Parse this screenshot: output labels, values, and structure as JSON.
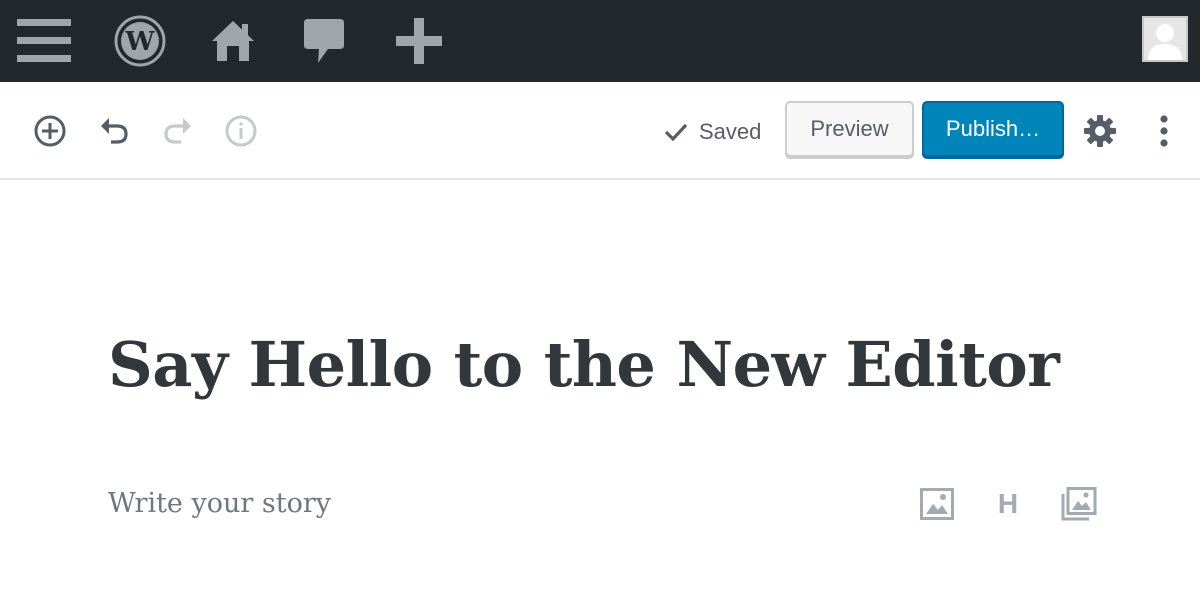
{
  "admin_bar": {
    "icons": [
      "menu-icon",
      "wordpress-logo-icon",
      "home-icon",
      "comment-icon",
      "plus-icon"
    ],
    "avatar_icon": "user-avatar-icon"
  },
  "toolbar": {
    "left_icons": [
      "add-block-icon",
      "undo-icon",
      "redo-icon",
      "info-icon"
    ],
    "saved_label": "Saved",
    "preview_label": "Preview",
    "publish_label": "Publish…",
    "settings_icon": "gear-icon",
    "more_icon": "vertical-ellipsis-icon"
  },
  "editor": {
    "title": "Say Hello to the New Editor",
    "placeholder": "Write your story",
    "quick_inserters": [
      "image-icon",
      "heading-icon",
      "gallery-icon"
    ],
    "heading_glyph": "H"
  },
  "colors": {
    "admin_bar_bg": "#23282d",
    "publish_blue": "#0085ba",
    "text_dark": "#32373c",
    "placeholder_gray": "#6c7781"
  }
}
